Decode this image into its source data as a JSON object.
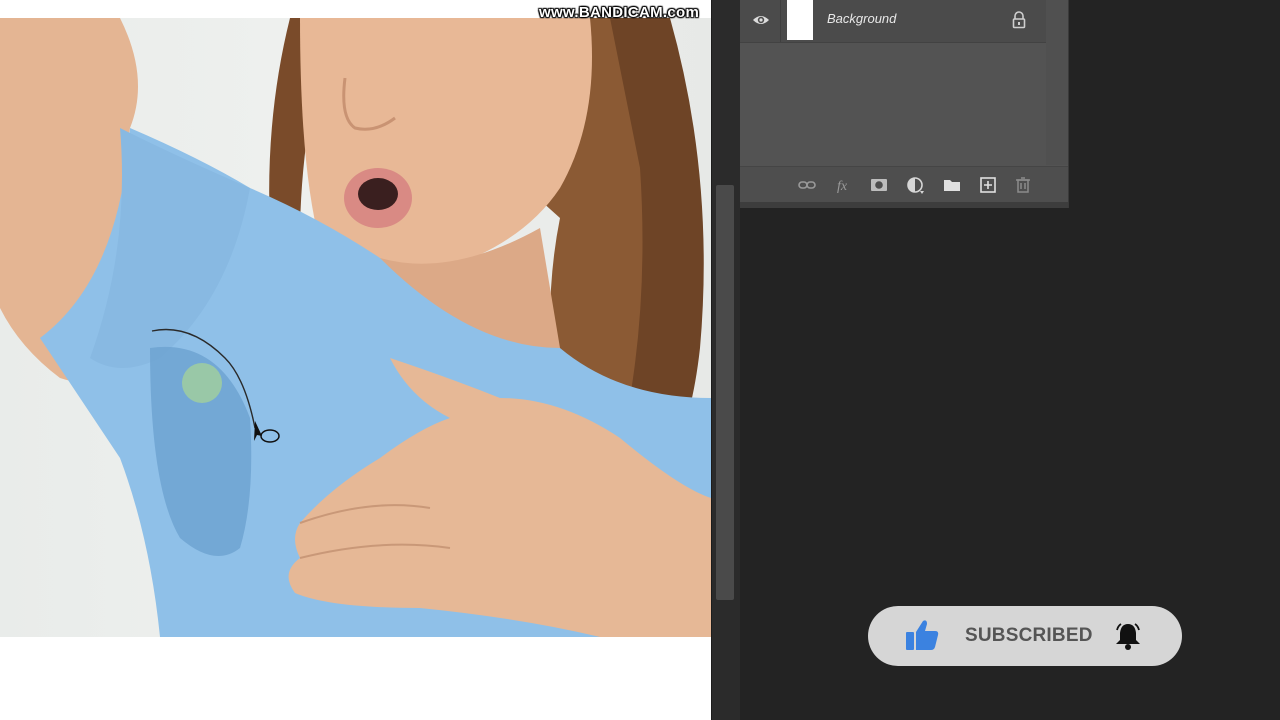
{
  "watermark": "www.BANDICAM.com",
  "layers_panel": {
    "layers": [
      {
        "name": "Background",
        "visible": true,
        "locked": true
      }
    ],
    "footer_icons": [
      "link-layers-icon",
      "fx-icon",
      "add-mask-icon",
      "adjustment-layer-icon",
      "folder-icon",
      "new-layer-icon",
      "trash-icon"
    ]
  },
  "overlay": {
    "subscribe_label": "SUBSCRIBED",
    "thumb_color": "#3b82e0",
    "bell_color": "#111111"
  },
  "colors": {
    "app_bg": "#232323",
    "panel_bg": "#535353",
    "shirt": "#8fc0e8"
  }
}
